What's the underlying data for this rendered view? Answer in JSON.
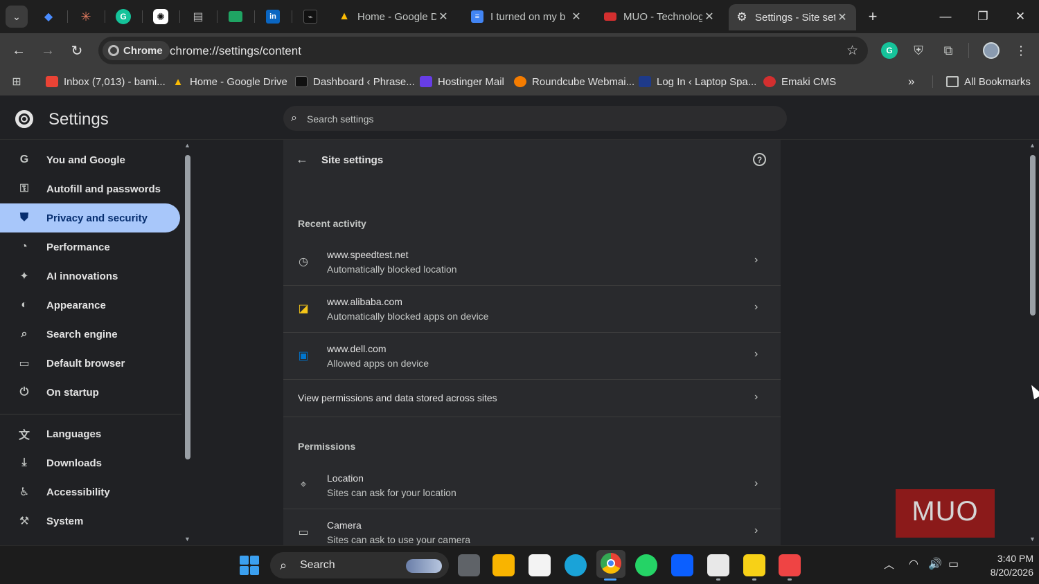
{
  "browser": {
    "tabs": [
      {
        "title": "Home - Google D",
        "close": "✕"
      },
      {
        "title": "I turned on my b",
        "close": "✕"
      },
      {
        "title": "MUO - Technolog",
        "close": "✕"
      },
      {
        "title": "Settings - Site set",
        "close": "✕"
      }
    ],
    "new_tab": "+",
    "window": {
      "minimize": "—",
      "restore": "❐",
      "close": "✕"
    },
    "toolbar": {
      "back": "←",
      "forward": "→",
      "reload": "↻",
      "chip_label": "Chrome",
      "url": "chrome://settings/content",
      "star": "☆",
      "menu": "⋮"
    },
    "bookmarks": [
      {
        "label": "Inbox (7,013) - bami...",
        "color": "#ea4335"
      },
      {
        "label": "Home - Google Drive",
        "color": "#fbbc04"
      },
      {
        "label": "Dashboard ‹ Phrase...",
        "color": "#111111"
      },
      {
        "label": "Hostinger Mail",
        "color": "#673de6"
      },
      {
        "label": "Roundcube Webmai...",
        "color": "#f57c00"
      },
      {
        "label": "Log In ‹ Laptop Spa...",
        "color": "#1e3a8a"
      },
      {
        "label": "Emaki CMS",
        "color": "#d32f2f"
      }
    ],
    "bookmarks_overflow": "»",
    "all_bookmarks": "All Bookmarks"
  },
  "settings": {
    "title": "Settings",
    "search_placeholder": "Search settings",
    "nav": [
      {
        "label": "You and Google",
        "icon": "G"
      },
      {
        "label": "Autofill and passwords",
        "icon": "⚿"
      },
      {
        "label": "Privacy and security",
        "icon": "⛊"
      },
      {
        "label": "Performance",
        "icon": "◔"
      },
      {
        "label": "AI innovations",
        "icon": "✦"
      },
      {
        "label": "Appearance",
        "icon": "◐"
      },
      {
        "label": "Search engine",
        "icon": "⌕"
      },
      {
        "label": "Default browser",
        "icon": "▭"
      },
      {
        "label": "On startup",
        "icon": "⏻"
      },
      {
        "label": "Languages",
        "icon": "文"
      },
      {
        "label": "Downloads",
        "icon": "⤓"
      },
      {
        "label": "Accessibility",
        "icon": "♿"
      },
      {
        "label": "System",
        "icon": "⚒"
      }
    ],
    "page": {
      "title": "Site settings",
      "back": "←",
      "help": "?",
      "recent_activity": "Recent activity",
      "recent": [
        {
          "site": "www.speedtest.net",
          "detail": "Automatically blocked location",
          "icon": "◷"
        },
        {
          "site": "www.alibaba.com",
          "detail": "Automatically blocked apps on device",
          "icon": "◪"
        },
        {
          "site": "www.dell.com",
          "detail": "Allowed apps on device",
          "icon": "▣"
        }
      ],
      "view_all": "View permissions and data stored across sites",
      "permissions_heading": "Permissions",
      "permissions": [
        {
          "title": "Location",
          "detail": "Sites can ask for your location",
          "icon": "⌖"
        },
        {
          "title": "Camera",
          "detail": "Sites can ask to use your camera",
          "icon": "▭"
        }
      ],
      "chevron": "›"
    }
  },
  "overlay": {
    "watermark": "MUO"
  },
  "taskbar": {
    "search_label": "Search",
    "time": "3:40 PM",
    "date": "8/20/2026"
  }
}
